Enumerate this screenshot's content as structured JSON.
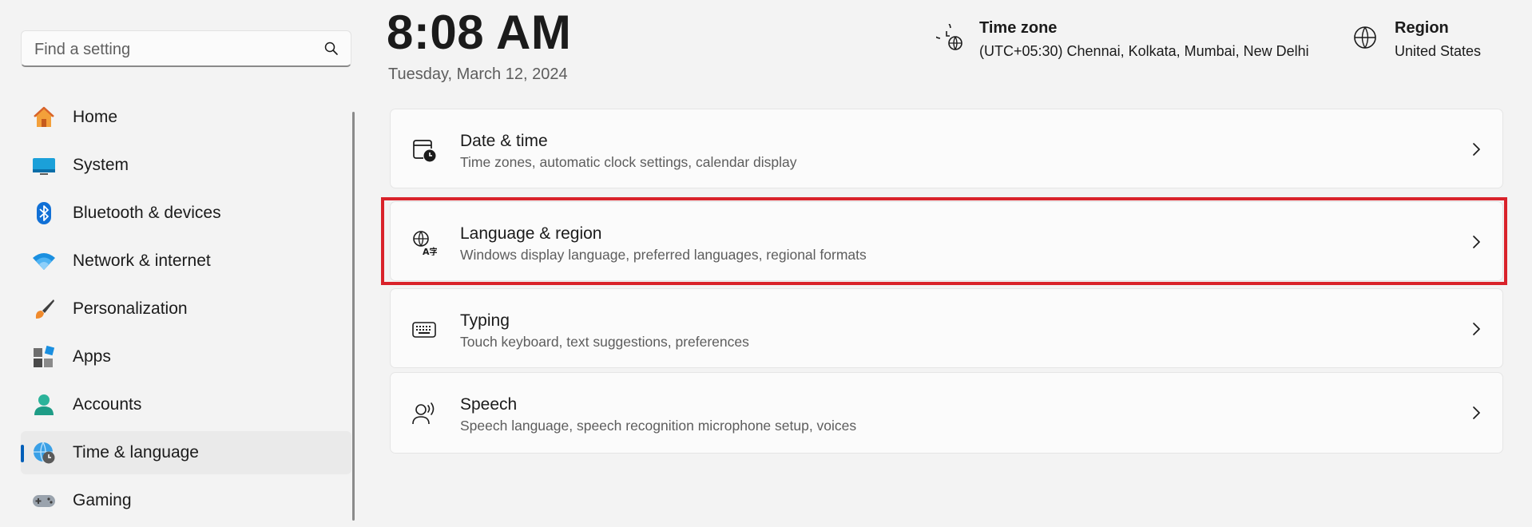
{
  "search": {
    "placeholder": "Find a setting"
  },
  "sidebar": {
    "items": [
      {
        "label": "Home",
        "icon": "home-icon"
      },
      {
        "label": "System",
        "icon": "system-icon"
      },
      {
        "label": "Bluetooth & devices",
        "icon": "bluetooth-icon"
      },
      {
        "label": "Network & internet",
        "icon": "wifi-icon"
      },
      {
        "label": "Personalization",
        "icon": "brush-icon"
      },
      {
        "label": "Apps",
        "icon": "apps-icon"
      },
      {
        "label": "Accounts",
        "icon": "account-icon"
      },
      {
        "label": "Time & language",
        "icon": "globe-clock-icon",
        "active": true
      },
      {
        "label": "Gaming",
        "icon": "gamepad-icon"
      }
    ]
  },
  "header": {
    "time": "8:08 AM",
    "date": "Tuesday, March 12, 2024",
    "timezone": {
      "title": "Time zone",
      "value": "(UTC+05:30) Chennai, Kolkata, Mumbai, New Delhi"
    },
    "region": {
      "title": "Region",
      "value": "United States"
    }
  },
  "cards": [
    {
      "title": "Date & time",
      "subtitle": "Time zones, automatic clock settings, calendar display",
      "icon": "calendar-clock-icon"
    },
    {
      "title": "Language & region",
      "subtitle": "Windows display language, preferred languages, regional formats",
      "icon": "language-icon",
      "highlighted": true
    },
    {
      "title": "Typing",
      "subtitle": "Touch keyboard, text suggestions, preferences",
      "icon": "keyboard-icon"
    },
    {
      "title": "Speech",
      "subtitle": "Speech language, speech recognition microphone setup, voices",
      "icon": "speech-icon"
    }
  ],
  "colors": {
    "accent": "#005fb8",
    "highlight": "#d9222a",
    "background": "#f3f3f3"
  }
}
